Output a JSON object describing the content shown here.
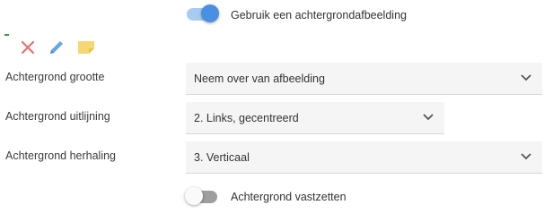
{
  "background_image_toggle": {
    "label": "Gebruik een achtergrondafbeelding",
    "on": true
  },
  "toolbar": {
    "icons": [
      "close-icon",
      "edit-pencil-icon",
      "note-icon"
    ],
    "colors": {
      "close": "#e57373",
      "edit": "#64a7e4",
      "note": "#f7d774"
    }
  },
  "fields": [
    {
      "label": "Achtergrond grootte",
      "value": "Neem over van afbeelding"
    },
    {
      "label": "Achtergrond uitlijning",
      "value": "2. Links, gecentreerd"
    },
    {
      "label": "Achtergrond herhaling",
      "value": "3. Verticaal"
    }
  ],
  "fixed_toggle": {
    "label": "Achtergrond vastzetten",
    "on": false
  },
  "accent_color": "#4a90e2"
}
